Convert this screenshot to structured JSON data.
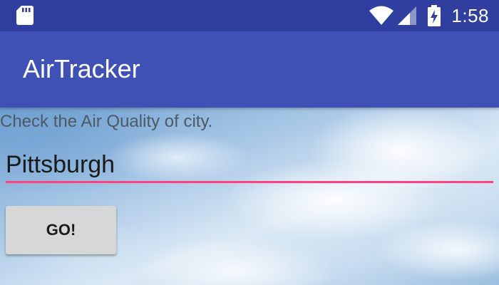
{
  "status_bar": {
    "time": "1:58",
    "icons": [
      "sd-card-icon",
      "wifi-icon",
      "signal-icon",
      "battery-charging-icon"
    ]
  },
  "app_bar": {
    "title": "AirTracker",
    "color": "#3f51b5"
  },
  "main": {
    "subtitle": "Check the Air Quality of city.",
    "city_input": {
      "value": "Pittsburgh",
      "accent_color": "#ff4081"
    },
    "go_button": {
      "label": "GO!"
    }
  },
  "colors": {
    "status_bar": "#303f9f",
    "app_bar": "#3f51b5",
    "input_underline": "#ff4081",
    "button": "#d6d7d7"
  }
}
